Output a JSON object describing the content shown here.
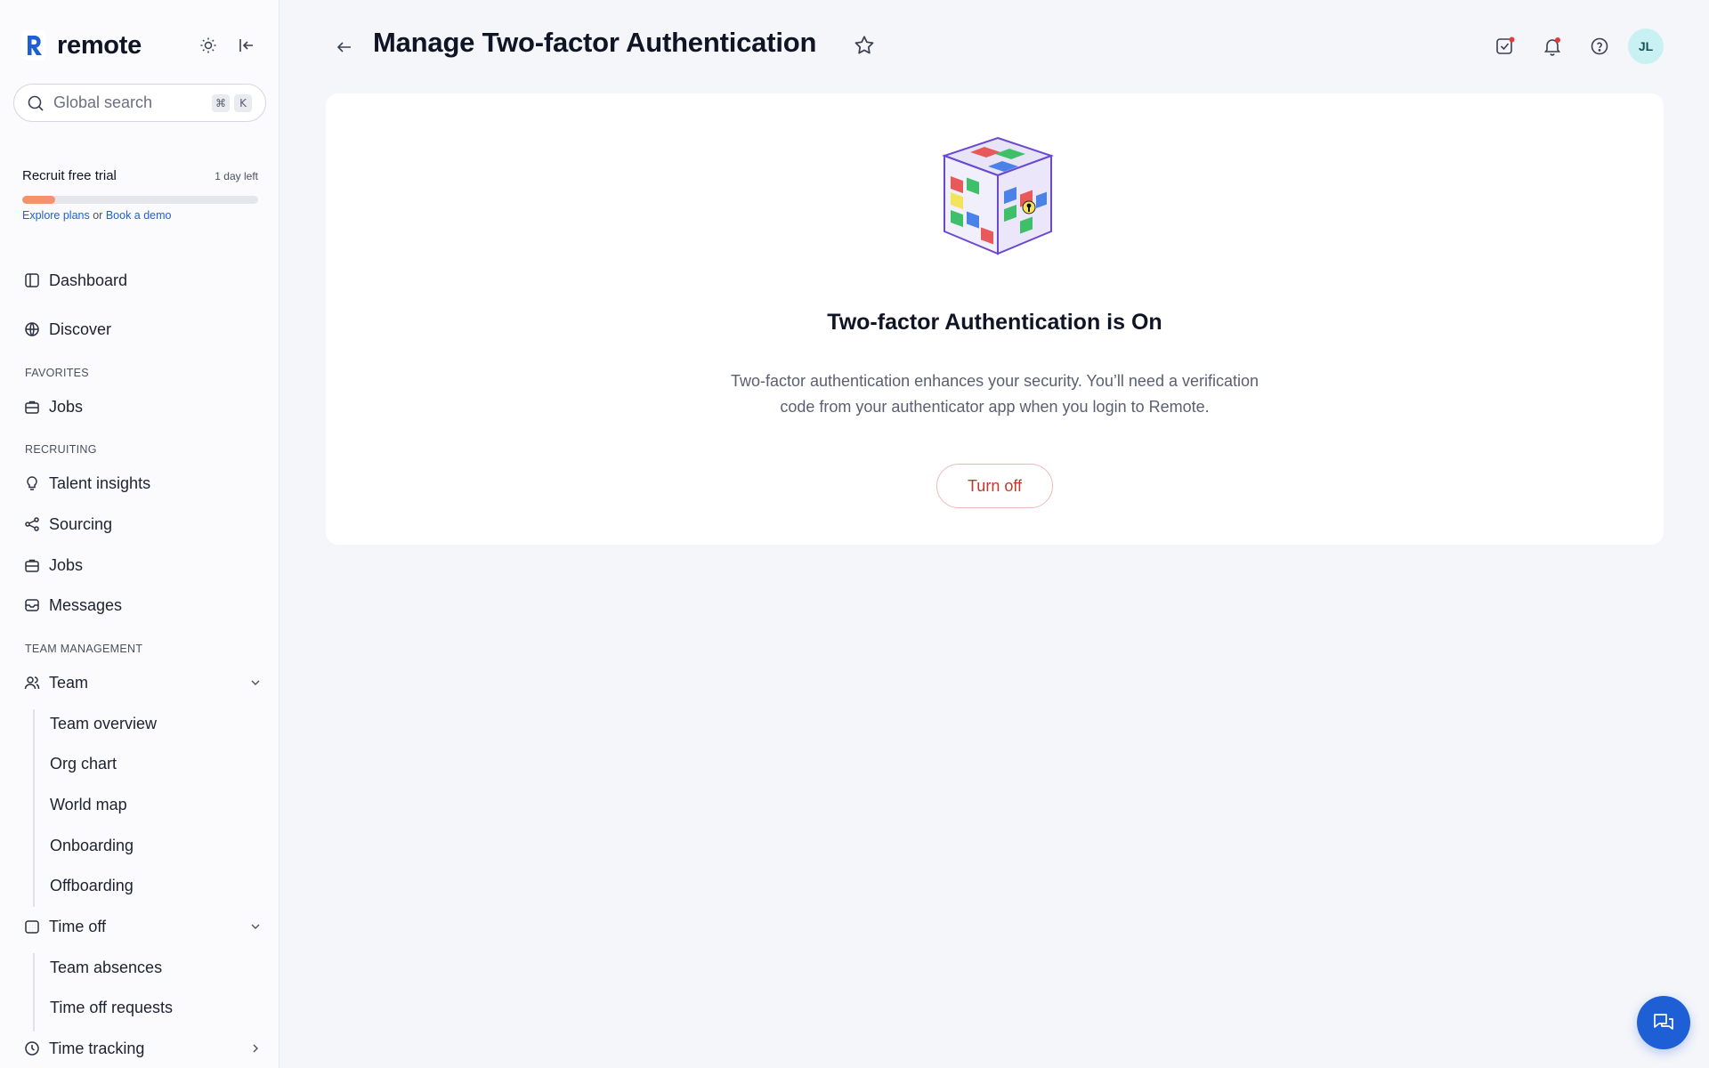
{
  "brand": {
    "name": "remote"
  },
  "search": {
    "placeholder": "Global search",
    "key1": "⌘",
    "key2": "K"
  },
  "trial": {
    "title": "Recruit free trial",
    "remaining": "1 day left",
    "progress": 0.14,
    "link1": "Explore plans",
    "or": "or",
    "link2": "Book a demo"
  },
  "nav": {
    "dashboard": "Dashboard",
    "discover": "Discover",
    "favorites_label": "FAVORITES",
    "fav_jobs": "Jobs",
    "recruiting_label": "RECRUITING",
    "talent_insights": "Talent insights",
    "sourcing": "Sourcing",
    "jobs": "Jobs",
    "messages": "Messages",
    "team_mgmt_label": "TEAM MANAGEMENT",
    "team": "Team",
    "team_sub": [
      "Team overview",
      "Org chart",
      "World map",
      "Onboarding",
      "Offboarding"
    ],
    "time_off": "Time off",
    "time_off_sub": [
      "Team absences",
      "Time off requests"
    ],
    "time_tracking": "Time tracking"
  },
  "header": {
    "title": "Manage Two-factor Authentication",
    "avatar": "JL"
  },
  "card": {
    "title": "Two-factor Authentication is On",
    "desc_line1": "Two-factor authentication enhances your security. You’ll need a verification",
    "desc_line2": "code from your authenticator app when you login to Remote.",
    "button": "Turn off"
  },
  "colors": {
    "accent": "#1f5fd6",
    "progress": "#f5916b",
    "danger": "#c0392b",
    "avatar_bg": "#c9f1f3"
  }
}
